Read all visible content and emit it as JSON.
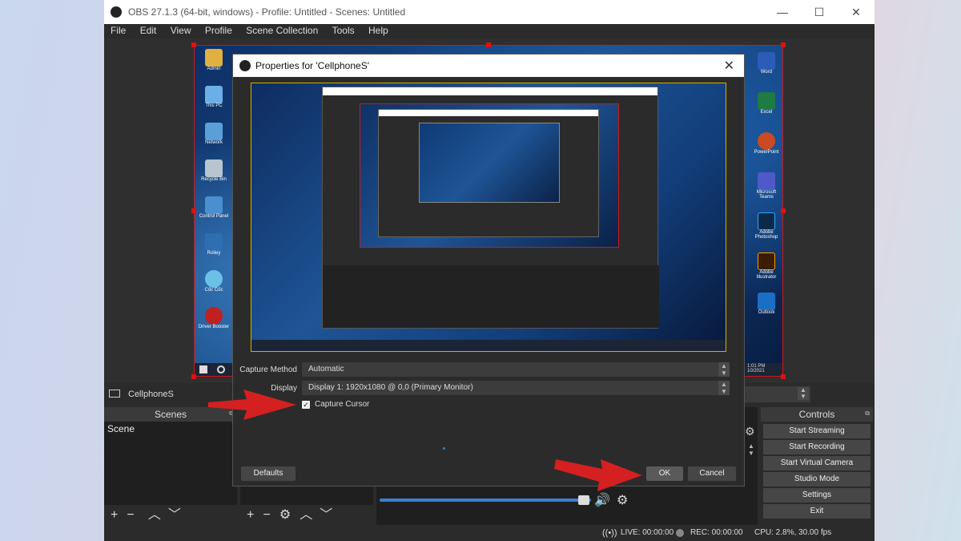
{
  "window": {
    "title": "OBS 27.1.3 (64-bit, windows) - Profile: Untitled - Scenes: Untitled",
    "minimize": "—",
    "maximize": "☐",
    "close": "✕"
  },
  "menu": [
    "File",
    "Edit",
    "View",
    "Profile",
    "Scene Collection",
    "Tools",
    "Help"
  ],
  "desktop_icons_left": [
    {
      "label": "Admin",
      "color": "#e0b040"
    },
    {
      "label": "This PC",
      "color": "#6ab0e6"
    },
    {
      "label": "Network",
      "color": "#5aa0d8"
    },
    {
      "label": "Recycle Bin",
      "color": "#b8c4d0"
    },
    {
      "label": "Control Panel",
      "color": "#4a8fd0"
    },
    {
      "label": "Rolley",
      "color": "#2d6fb0"
    },
    {
      "label": "Cốc Cốc",
      "color": "#6bc0e8"
    },
    {
      "label": "Driver Booster",
      "color": "#c02020"
    }
  ],
  "desktop_icons_right": [
    {
      "label": "Word",
      "color": "#2b5cb8"
    },
    {
      "label": "Excel",
      "color": "#1f7a43"
    },
    {
      "label": "PowerPoint",
      "color": "#c94a23"
    },
    {
      "label": "Microsoft Teams",
      "color": "#5059c9"
    },
    {
      "label": "Adobe Photoshop",
      "color": "#0b2a4a"
    },
    {
      "label": "Adobe Illustrator",
      "color": "#3a1d05"
    },
    {
      "label": "Outlook",
      "color": "#1a6fc4"
    }
  ],
  "preview_clock": {
    "time": "1:01 PM",
    "date": "10/2021"
  },
  "source_bar": {
    "source_name": "CellphoneS"
  },
  "docks": {
    "scenes": {
      "title": "Scenes",
      "items": [
        "Scene"
      ]
    },
    "controls": {
      "title": "Controls",
      "buttons": [
        "Start Streaming",
        "Start Recording",
        "Start Virtual Camera",
        "Studio Mode",
        "Settings",
        "Exit"
      ]
    }
  },
  "status": {
    "live": "LIVE: 00:00:00",
    "rec": "REC: 00:00:00",
    "cpu": "CPU: 2.8%, 30.00 fps"
  },
  "dialog": {
    "title": "Properties for 'CellphoneS'",
    "close": "✕",
    "capture_method_label": "Capture Method",
    "capture_method_value": "Automatic",
    "display_label": "Display",
    "display_value": "Display 1: 1920x1080 @ 0,0 (Primary Monitor)",
    "capture_cursor_label": "Capture Cursor",
    "capture_cursor_checked": true,
    "defaults_button": "Defaults",
    "ok_button": "OK",
    "cancel_button": "Cancel"
  },
  "colors": {
    "obs_bg": "#2b2b2b",
    "selection_red": "#d01818",
    "arrow_red": "#d42020",
    "accent_blue": "#3a7fd0"
  }
}
